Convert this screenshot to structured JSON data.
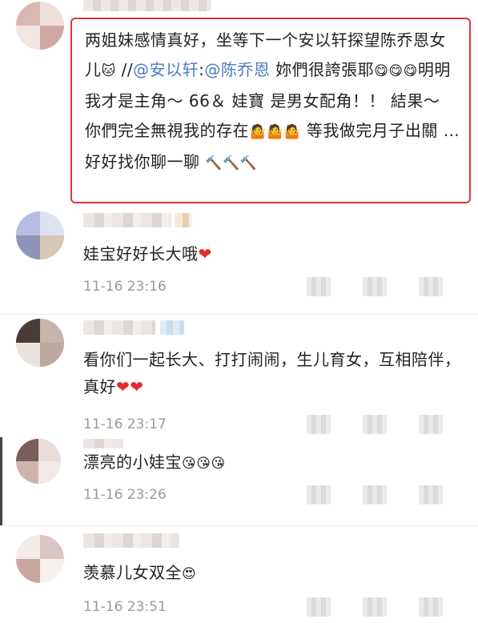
{
  "reply": {
    "text_a": "两姐妹感情真好，坐等下一个安以轩探望陈乔恩女儿",
    "emoji_cat": "🐱",
    "sep": " //",
    "mention_1": "@安以轩",
    "colon": ":",
    "mention_2": "@陈乔恩",
    "text_b": " 妳們很誇張耶",
    "emoji_yum": "😋😋😋",
    "text_c": "明明我才是主角～ 66＆ 娃寶 是男女配角！！ 結果～ 你們完全無視我的存在",
    "emoji_shrug": "🤷🤷🤷",
    "text_d": " 等我做完月子出關 … 好好找你聊一聊 ",
    "emoji_hammer": "🔨🔨🔨"
  },
  "comments": [
    {
      "text": "娃宝好好长大哦",
      "emoji": "❤",
      "time": "11-16 23:16"
    },
    {
      "text": "看你们一起长大、打打闹闹，生儿育女，互相陪伴，真好",
      "emoji": "❤❤",
      "time": "11-16 23:17"
    },
    {
      "text": "漂亮的小娃宝",
      "emoji": "😘😘😘",
      "time": "11-16 23:26"
    },
    {
      "text": "羡慕儿女双全",
      "emoji": "😍",
      "time": "11-16 23:51"
    }
  ],
  "colors": {
    "highlight_border": "#e0353a",
    "mention": "#4d7cc4",
    "heart": "#e22b2b",
    "timestamp": "#9a9a9a"
  },
  "icons": [
    "avatar-blurred",
    "like-icon",
    "comment-icon",
    "share-icon"
  ]
}
